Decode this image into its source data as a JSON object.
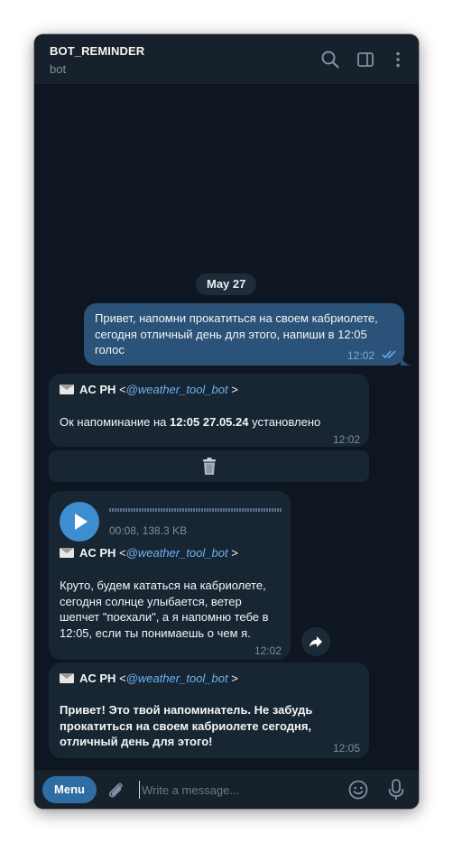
{
  "header": {
    "title": "BOT_REMINDER",
    "subtitle": "bot"
  },
  "date_separator": "May 27",
  "messages": [
    {
      "direction": "outgoing",
      "text_lines": [
        "Привет, напомни прокатиться на своем кабриолете,",
        "сегодня отличный день для этого, напиши в 12:05",
        "голос"
      ],
      "time": "12:02",
      "read": true
    },
    {
      "direction": "incoming",
      "sender_name": "AC PH",
      "sender_open": "<",
      "sender_username": "@weather_tool_bot",
      "sender_close": ">",
      "text_before": "Ок напоминание на ",
      "text_bold": "12:05 27.05.24",
      "text_after": " установлено",
      "time": "12:02",
      "inline_button_icon": "trash-icon"
    },
    {
      "direction": "incoming",
      "type": "voice",
      "voice_meta": "00:08, 138.3 KB",
      "sender_name": "AC PH",
      "sender_open": "<",
      "sender_username": "@weather_tool_bot",
      "sender_close": ">",
      "text_lines": [
        "Круто, будем кататься на кабриолете,",
        "сегодня солнце улыбается, ветер",
        "шепчет \"поехали\", а я напомню тебе в",
        "12:05, если ты понимаешь о чем я."
      ],
      "time": "12:02"
    },
    {
      "direction": "incoming",
      "sender_name": "AC PH",
      "sender_open": "<",
      "sender_username": "@weather_tool_bot",
      "sender_close": ">",
      "bold_lines": [
        "Привет! Это твой напоминатель. Не забудь",
        "прокатиться на своем кабриолете сегодня,",
        "отличный день для этого!"
      ],
      "time": "12:05"
    }
  ],
  "composer": {
    "menu_label": "Menu",
    "placeholder": "Write a message..."
  },
  "colors": {
    "background": "#0e1621",
    "header": "#17212b",
    "outgoing_bubble": "#2b5278",
    "incoming_bubble": "#182533",
    "accent": "#2f6ea5",
    "link": "#6ab3f3"
  }
}
